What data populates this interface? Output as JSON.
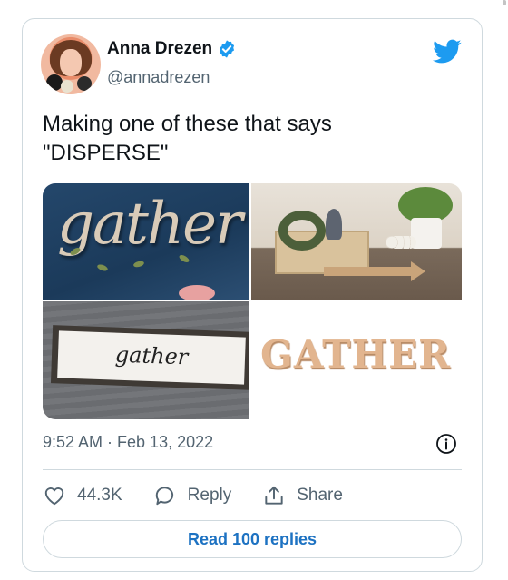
{
  "author": {
    "display_name": "Anna Drezen",
    "handle": "@annadrezen",
    "verified": true,
    "avatar_icon": "avatar-photo"
  },
  "brand_icon": "twitter-bird-icon",
  "brand_color": "#1d9bf0",
  "tweet": {
    "text": "Making one of these that says\n\"DISPERSE\""
  },
  "media": [
    {
      "name": "gather-script-blue-wall",
      "word": "gather"
    },
    {
      "name": "tray-decor-with-arrow",
      "word": ""
    },
    {
      "name": "gather-framed-sign",
      "word": "gather"
    },
    {
      "name": "gather-wood-letters",
      "word": "GATHER"
    }
  ],
  "meta": {
    "timestamp": "9:52 AM · Feb 13, 2022",
    "info_icon": "info-icon"
  },
  "actions": {
    "likes": "44.3K",
    "reply_label": "Reply",
    "share_label": "Share"
  },
  "read_replies_label": "Read 100 replies",
  "link_color": "#1d72c2"
}
